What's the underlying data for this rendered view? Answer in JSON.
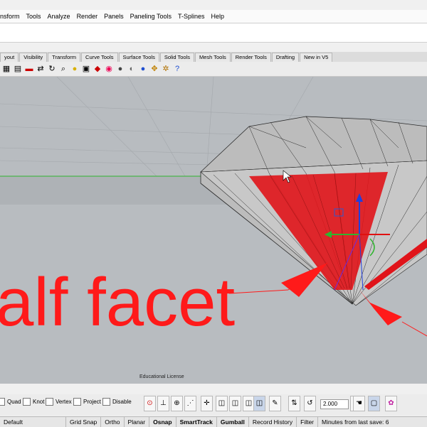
{
  "menu": {
    "items": [
      "nsform",
      "Tools",
      "Analyze",
      "Render",
      "Panels",
      "Paneling Tools",
      "T-Splines",
      "Help"
    ]
  },
  "tabs": [
    "yout",
    "Visibility",
    "Transform",
    "Curve Tools",
    "Surface Tools",
    "Solid Tools",
    "Mesh Tools",
    "Render Tools",
    "Drafting",
    "New in V5"
  ],
  "toolbar_icons": [
    "grid-icon",
    "layout-icon",
    "car-icon",
    "arrows-icon",
    "circle-arrow-icon",
    "zoom-icon",
    "light-bulb-icon",
    "clipboard-icon",
    "paint-bucket-icon",
    "color-wheel-icon",
    "sphere-icon",
    "shaded-sphere-icon",
    "blue-sphere-icon",
    "puzzle-icon",
    "gears-icon",
    "help-icon"
  ],
  "viewport": {
    "overlay_label": "alf facet",
    "license": "Educational License"
  },
  "snap_filters": {
    "items": [
      {
        "label": "Quad",
        "checked": false
      },
      {
        "label": "Knot",
        "checked": false
      },
      {
        "label": "Vertex",
        "checked": false
      },
      {
        "label": "Project",
        "checked": false
      },
      {
        "label": "Disable",
        "checked": false
      }
    ]
  },
  "gumball_tools": {
    "value": "2.000"
  },
  "status_bar": {
    "layer": "Default",
    "items": [
      "Grid Snap",
      "Ortho",
      "Planar",
      "Osnap",
      "SmartTrack",
      "Gumball",
      "Record History",
      "Filter",
      "Minutes from last save: 6"
    ],
    "active": [
      "Osnap",
      "SmartTrack",
      "Gumball"
    ]
  },
  "colors": {
    "accent_red": "#ff1a1a",
    "viewport_bg": "#b8bcc0",
    "gem_wire": "#2a2a2a"
  }
}
